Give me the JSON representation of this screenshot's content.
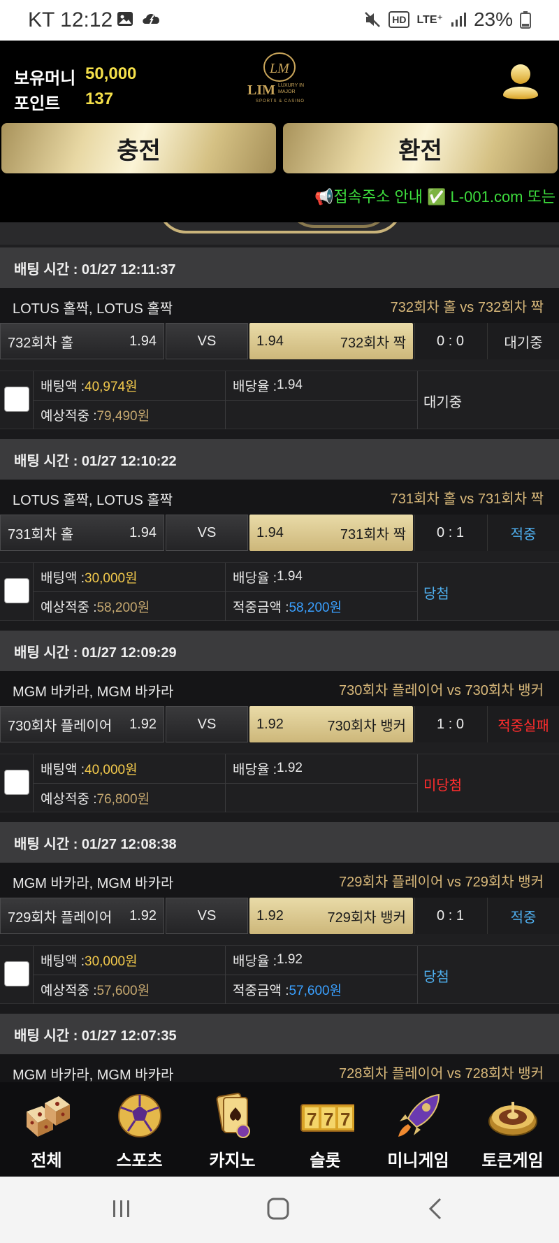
{
  "status_bar": {
    "carrier_time": "KT 12:12",
    "icons_left": [
      "image-icon",
      "cloud-icon"
    ],
    "icons_right": [
      "mute-icon",
      "hd-icon",
      "lte-icon",
      "signal-icon"
    ],
    "battery": "23%"
  },
  "header": {
    "money_label": "보유머니",
    "money_value": "50,000",
    "points_label": "포인트",
    "points_value": "137",
    "logo_text": "LIM",
    "logo_sub": "LUXURY IN MAJOR",
    "logo_tag": "SPORTS & CASINO",
    "deposit_label": "충전",
    "withdraw_label": "환전",
    "marquee": "📢접속주소 안내 ✅ L-001.com 또는"
  },
  "bets": [
    {
      "time": "배팅 시간 : 01/27 12:11:37",
      "game": "LOTUS 홀짝, LOTUS 홀짝",
      "match": "732회차 홀  vs  732회차 짝",
      "home": "732회차 홀",
      "home_odds": "1.94",
      "vs": "VS",
      "away_odds": "1.94",
      "away": "732회차 짝",
      "score": "0 : 0",
      "result": "대기중",
      "amount_label": "배팅액 :",
      "amount": "40,974원",
      "rate_label": "배당율 :",
      "rate": "1.94",
      "expected_label": "예상적중 :",
      "expected": "79,490원",
      "win_label": "",
      "win": "",
      "status": "대기중"
    },
    {
      "time": "배팅 시간 : 01/27 12:10:22",
      "game": "LOTUS 홀짝, LOTUS 홀짝",
      "match": "731회차 홀  vs  731회차 짝",
      "home": "731회차 홀",
      "home_odds": "1.94",
      "vs": "VS",
      "away_odds": "1.94",
      "away": "731회차 짝",
      "score": "0 : 1",
      "result": "적중",
      "amount_label": "배팅액 :",
      "amount": "30,000원",
      "rate_label": "배당율 :",
      "rate": "1.94",
      "expected_label": "예상적중 :",
      "expected": "58,200원",
      "win_label": "적중금액 :",
      "win": "58,200원",
      "status": "당첨"
    },
    {
      "time": "배팅 시간 : 01/27 12:09:29",
      "game": "MGM 바카라, MGM 바카라",
      "match": "730회차 플레이어  vs  730회차 뱅커",
      "home": "730회차 플레이어",
      "home_odds": "1.92",
      "vs": "VS",
      "away_odds": "1.92",
      "away": "730회차 뱅커",
      "score": "1 : 0",
      "result": "적중실패",
      "amount_label": "배팅액 :",
      "amount": "40,000원",
      "rate_label": "배당율 :",
      "rate": "1.92",
      "expected_label": "예상적중 :",
      "expected": "76,800원",
      "win_label": "",
      "win": "",
      "status": "미당첨"
    },
    {
      "time": "배팅 시간 : 01/27 12:08:38",
      "game": "MGM 바카라, MGM 바카라",
      "match": "729회차 플레이어  vs  729회차 뱅커",
      "home": "729회차 플레이어",
      "home_odds": "1.92",
      "vs": "VS",
      "away_odds": "1.92",
      "away": "729회차 뱅커",
      "score": "0 : 1",
      "result": "적중",
      "amount_label": "배팅액 :",
      "amount": "30,000원",
      "rate_label": "배당율 :",
      "rate": "1.92",
      "expected_label": "예상적중 :",
      "expected": "57,600원",
      "win_label": "적중금액 :",
      "win": "57,600원",
      "status": "당첨"
    },
    {
      "time": "배팅 시간 : 01/27 12:07:35",
      "game": "MGM 바카라, MGM 바카라",
      "match": "728회차 플레이어  vs  728회차 뱅커"
    }
  ],
  "nav": [
    {
      "label": "전체",
      "icon": "dice-icon"
    },
    {
      "label": "스포츠",
      "icon": "soccer-ball-icon"
    },
    {
      "label": "카지노",
      "icon": "cards-icon"
    },
    {
      "label": "슬롯",
      "icon": "slot-777-icon"
    },
    {
      "label": "미니게임",
      "icon": "rocket-icon"
    },
    {
      "label": "토큰게임",
      "icon": "roulette-icon"
    }
  ],
  "colors": {
    "gold": "#d8c58a",
    "win": "#4fb0f0",
    "lose": "#ff2d2d",
    "amount": "#f2c94c"
  }
}
